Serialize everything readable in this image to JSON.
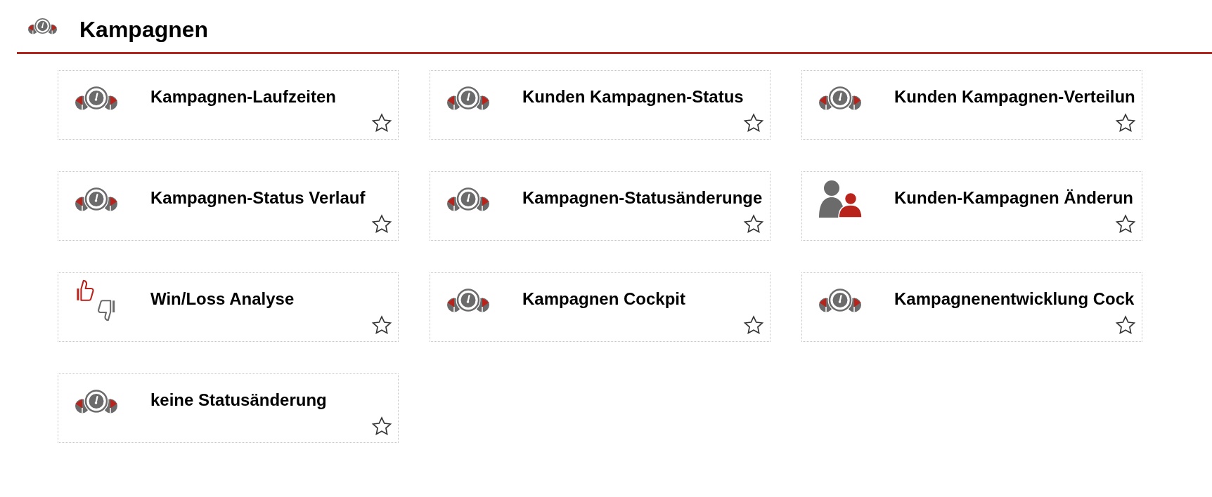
{
  "header": {
    "title": "Kampagnen"
  },
  "tiles": [
    {
      "kind": "gauge",
      "title": "Kampagnen-Laufzeiten",
      "favorite": false
    },
    {
      "kind": "gauge",
      "title": "Kunden Kampagnen-Status",
      "favorite": false
    },
    {
      "kind": "gauge",
      "title": "Kunden Kampagnen-Verteilun",
      "favorite": false
    },
    {
      "kind": "gauge",
      "title": "Kampagnen-Status Verlauf",
      "favorite": false
    },
    {
      "kind": "gauge",
      "title": "Kampagnen-Statusänderunge",
      "favorite": false
    },
    {
      "kind": "users",
      "title": "Kunden-Kampagnen Änderun",
      "favorite": false
    },
    {
      "kind": "thumbs",
      "title": "Win/Loss Analyse",
      "favorite": false
    },
    {
      "kind": "gauge",
      "title": "Kampagnen Cockpit",
      "favorite": false
    },
    {
      "kind": "gauge",
      "title": "Kampagnenentwicklung Cock",
      "favorite": false
    },
    {
      "kind": "gauge",
      "title": "keine Statusänderung",
      "favorite": false
    }
  ]
}
